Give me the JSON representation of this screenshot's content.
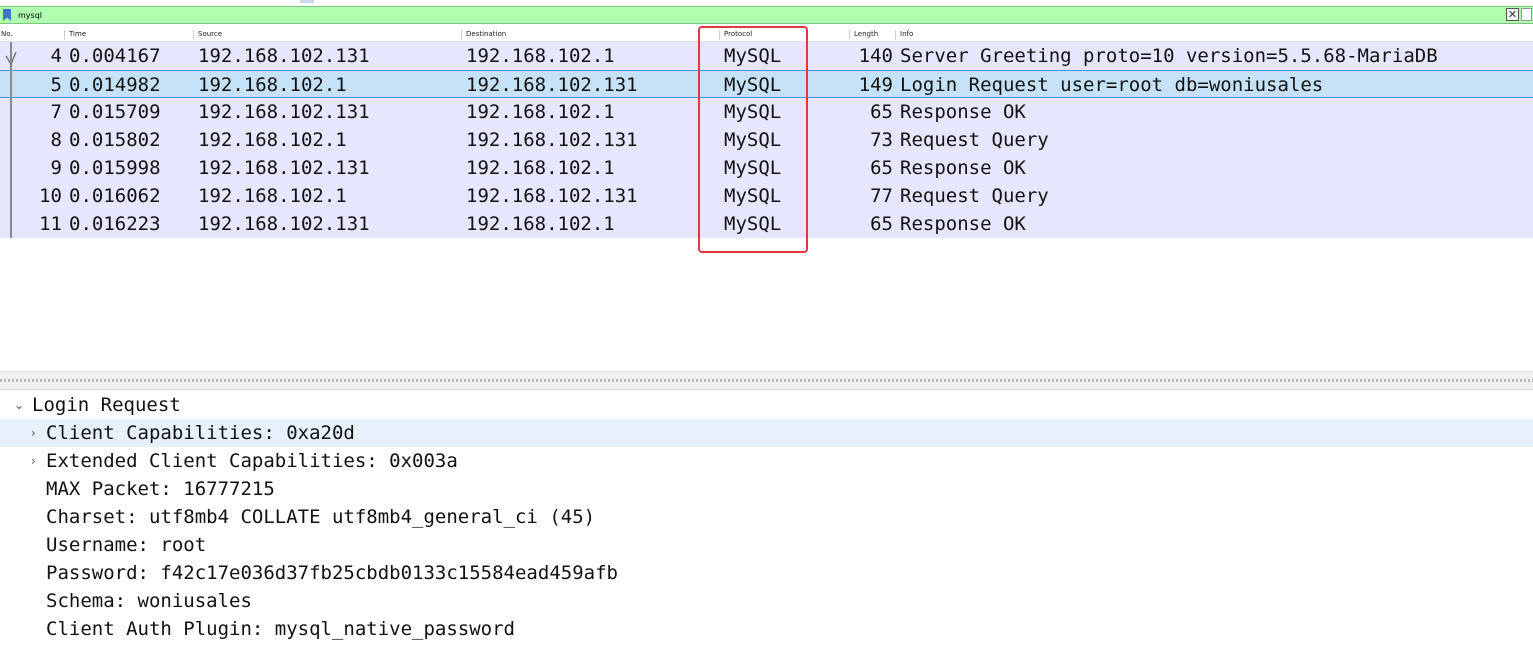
{
  "filter": {
    "value": "mysql",
    "clear_label": "✕"
  },
  "columns": [
    "No.",
    "Time",
    "Source",
    "Destination",
    "Protocol",
    "Length",
    "Info"
  ],
  "packets": [
    {
      "no": "4",
      "time": "0.004167",
      "source": "192.168.102.131",
      "destination": "192.168.102.1",
      "protocol": "MySQL",
      "length": "140",
      "info": "Server Greeting proto=10 version=5.5.68-MariaDB"
    },
    {
      "no": "5",
      "time": "0.014982",
      "source": "192.168.102.1",
      "destination": "192.168.102.131",
      "protocol": "MySQL",
      "length": "149",
      "info": "Login Request user=root db=woniusales"
    },
    {
      "no": "7",
      "time": "0.015709",
      "source": "192.168.102.131",
      "destination": "192.168.102.1",
      "protocol": "MySQL",
      "length": "65",
      "info": "Response OK"
    },
    {
      "no": "8",
      "time": "0.015802",
      "source": "192.168.102.1",
      "destination": "192.168.102.131",
      "protocol": "MySQL",
      "length": "73",
      "info": "Request Query"
    },
    {
      "no": "9",
      "time": "0.015998",
      "source": "192.168.102.131",
      "destination": "192.168.102.1",
      "protocol": "MySQL",
      "length": "65",
      "info": "Response OK"
    },
    {
      "no": "10",
      "time": "0.016062",
      "source": "192.168.102.1",
      "destination": "192.168.102.131",
      "protocol": "MySQL",
      "length": "77",
      "info": "Request Query"
    },
    {
      "no": "11",
      "time": "0.016223",
      "source": "192.168.102.131",
      "destination": "192.168.102.1",
      "protocol": "MySQL",
      "length": "65",
      "info": "Response OK"
    }
  ],
  "selected_packet": "5",
  "details": {
    "root": "Login Request",
    "items": [
      {
        "text": "Client Capabilities: 0xa20d",
        "expandable": true
      },
      {
        "text": "Extended Client Capabilities: 0x003a",
        "expandable": true
      },
      {
        "text": "MAX Packet: 16777215",
        "expandable": false
      },
      {
        "text": "Charset: utf8mb4 COLLATE utf8mb4_general_ci (45)",
        "expandable": false
      },
      {
        "text": "Username: root",
        "expandable": false
      },
      {
        "text": "Password: f42c17e036d37fb25cbdb0133c15584ead459afb",
        "expandable": false
      },
      {
        "text": "Schema: woniusales",
        "expandable": false
      },
      {
        "text": "Client Auth Plugin: mysql_native_password",
        "expandable": false
      }
    ]
  },
  "colors": {
    "row_bg": "#e7e6ff",
    "selected_bg": "#c5e2f8",
    "filter_bg": "#afffaf",
    "highlight": "#e0393f"
  }
}
